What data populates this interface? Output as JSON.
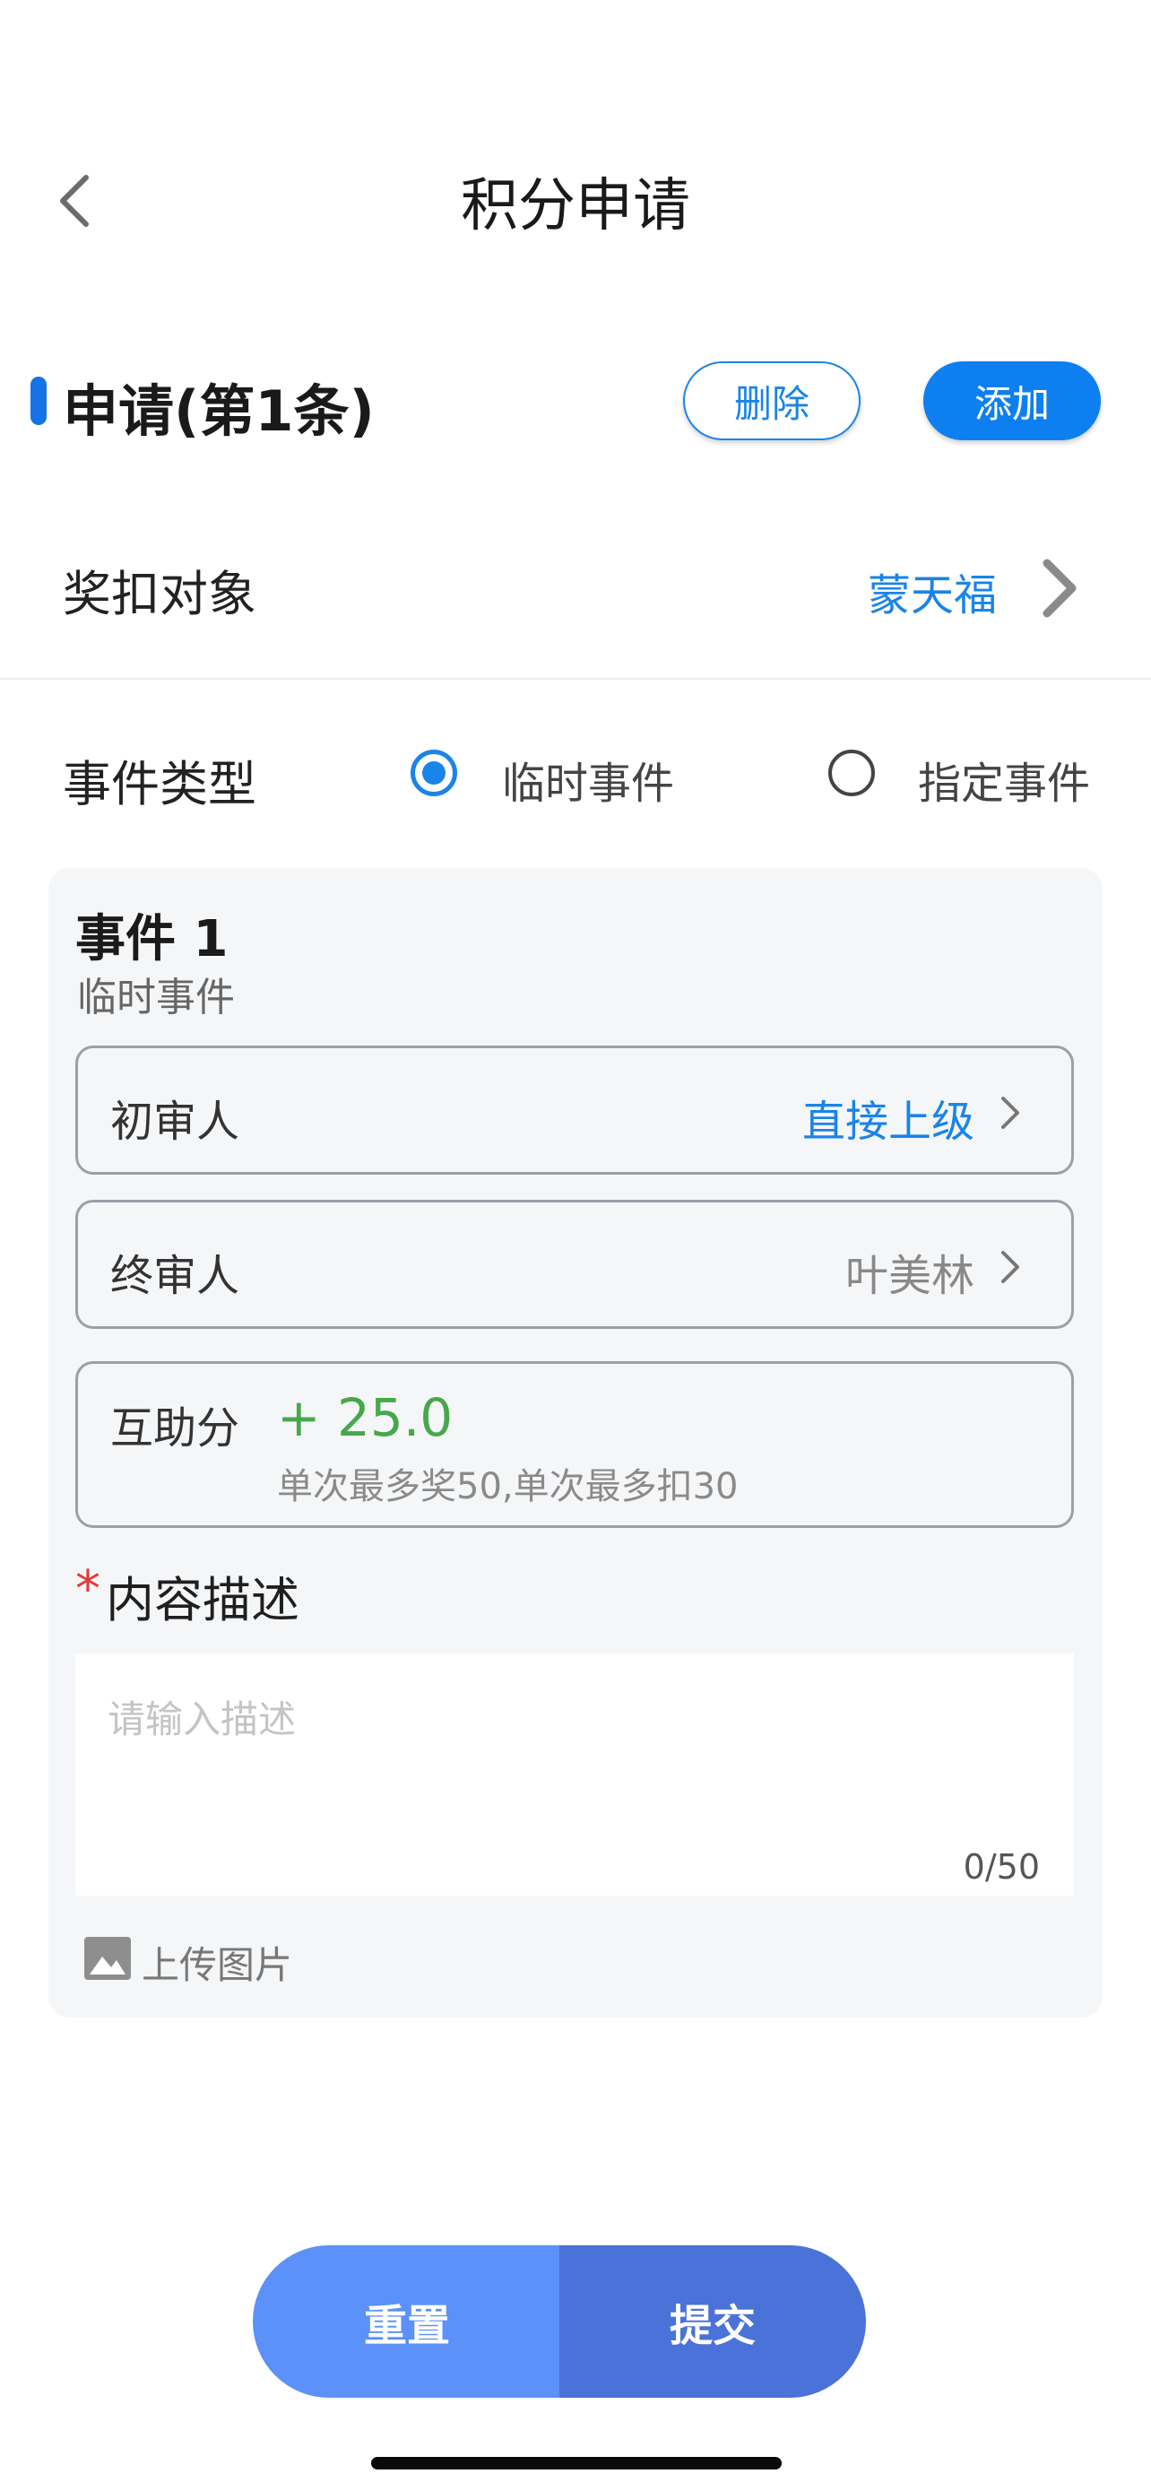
{
  "header": {
    "title": "积分申请",
    "back_icon": "chevron-left-icon"
  },
  "section": {
    "title": "申请(第1条)",
    "delete_label": "删除",
    "add_label": "添加",
    "accent_color": "#1473e6"
  },
  "target": {
    "label": "奖扣对象",
    "value": "蒙天福"
  },
  "event_type": {
    "label": "事件类型",
    "options": [
      {
        "label": "临时事件",
        "selected": true
      },
      {
        "label": "指定事件",
        "selected": false
      }
    ]
  },
  "event": {
    "title": "事件 1",
    "subtitle": "临时事件",
    "first_reviewer": {
      "label": "初审人",
      "value": "直接上级"
    },
    "final_reviewer": {
      "label": "终审人",
      "value": "叶美林"
    },
    "points": {
      "label": "互助分",
      "value": "+ 25.0",
      "hint": "单次最多奖50,单次最多扣30"
    },
    "description": {
      "required_mark": "*",
      "label": "内容描述",
      "placeholder": "请输入描述",
      "count": "0/50"
    },
    "upload_label": "上传图片"
  },
  "footer": {
    "reset_label": "重置",
    "submit_label": "提交"
  }
}
